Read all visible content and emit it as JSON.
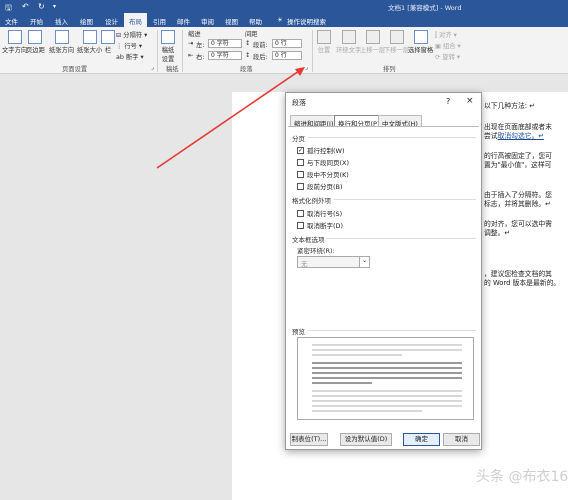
{
  "title_bar": {
    "doc_title": "文档1 [兼容模式] - Word",
    "save_icon": "save-icon",
    "undo_icon": "undo-icon",
    "redo_icon": "redo-icon"
  },
  "tabs": [
    "文件",
    "开始",
    "插入",
    "绘图",
    "设计",
    "布局",
    "引用",
    "邮件",
    "审阅",
    "视图",
    "帮助",
    "操作说明搜索"
  ],
  "active_tab": "布局",
  "ribbon": {
    "page_setup": {
      "label": "页面设置",
      "text_direction": "文字方向",
      "margins": "页边距",
      "orientation": "纸张方向",
      "size": "纸张大小",
      "columns": "栏",
      "breaks": "分隔符",
      "line_numbers": "行号",
      "hyphenation": "断字"
    },
    "draft": {
      "label": "稿纸",
      "button": "稿纸\n设置"
    },
    "paragraph": {
      "label": "段落",
      "indent": "缩进",
      "spacing": "间距",
      "left": "左:",
      "right": "右:",
      "left_val": "0 字符",
      "right_val": "0 字符",
      "before": "段前:",
      "after": "段后:",
      "before_val": "0 行",
      "after_val": "0 行"
    },
    "arrange": {
      "label": "排列",
      "position": "位置",
      "wrap": "环绕文字",
      "forward": "上移一层",
      "backward": "下移一层",
      "selection_pane": "选择窗格",
      "align": "对齐",
      "group": "组合",
      "rotate": "旋转"
    }
  },
  "document": {
    "lines": [
      "以下几种方法: ↵",
      "出现在页面底部或者末",
      "尝试",
      "取消勾选它。↵",
      "的行高被固定了，您可",
      "置为\"最小值\"，这样可",
      "由于插入了分隔符。您",
      "标志，并将其删除。↵",
      "的对齐，您可以选中需",
      "调整。↵",
      "，建议您检查文档的其",
      "的 Word 版本是最新的。"
    ]
  },
  "dialog": {
    "title": "段落",
    "help": "?",
    "close": "×",
    "tabs": [
      "缩进和间距(I)",
      "换行和分页(P)",
      "中文版式(H)"
    ],
    "active_tab": 1,
    "pagination": {
      "label": "分页",
      "options": [
        {
          "label": "孤行控制(W)",
          "checked": true
        },
        {
          "label": "与下段同页(X)",
          "checked": false
        },
        {
          "label": "段中不分页(K)",
          "checked": false
        },
        {
          "label": "段前分页(B)",
          "checked": false
        }
      ]
    },
    "format_exceptions": {
      "label": "格式化例外项",
      "options": [
        {
          "label": "取消行号(S)",
          "checked": false
        },
        {
          "label": "取消断字(D)",
          "checked": false
        }
      ]
    },
    "textbox_options": {
      "label": "文本框选项",
      "tight_wrap_label": "紧密环绕(R):",
      "tight_wrap_value": "无"
    },
    "preview": {
      "label": "预览"
    },
    "buttons": {
      "tabs": "制表位(T)...",
      "default": "设为默认值(D)",
      "ok": "确定",
      "cancel": "取消"
    }
  },
  "watermark": "头条 @布衣160",
  "colors": {
    "accent": "#2b579a",
    "arrow": "#e53935"
  }
}
